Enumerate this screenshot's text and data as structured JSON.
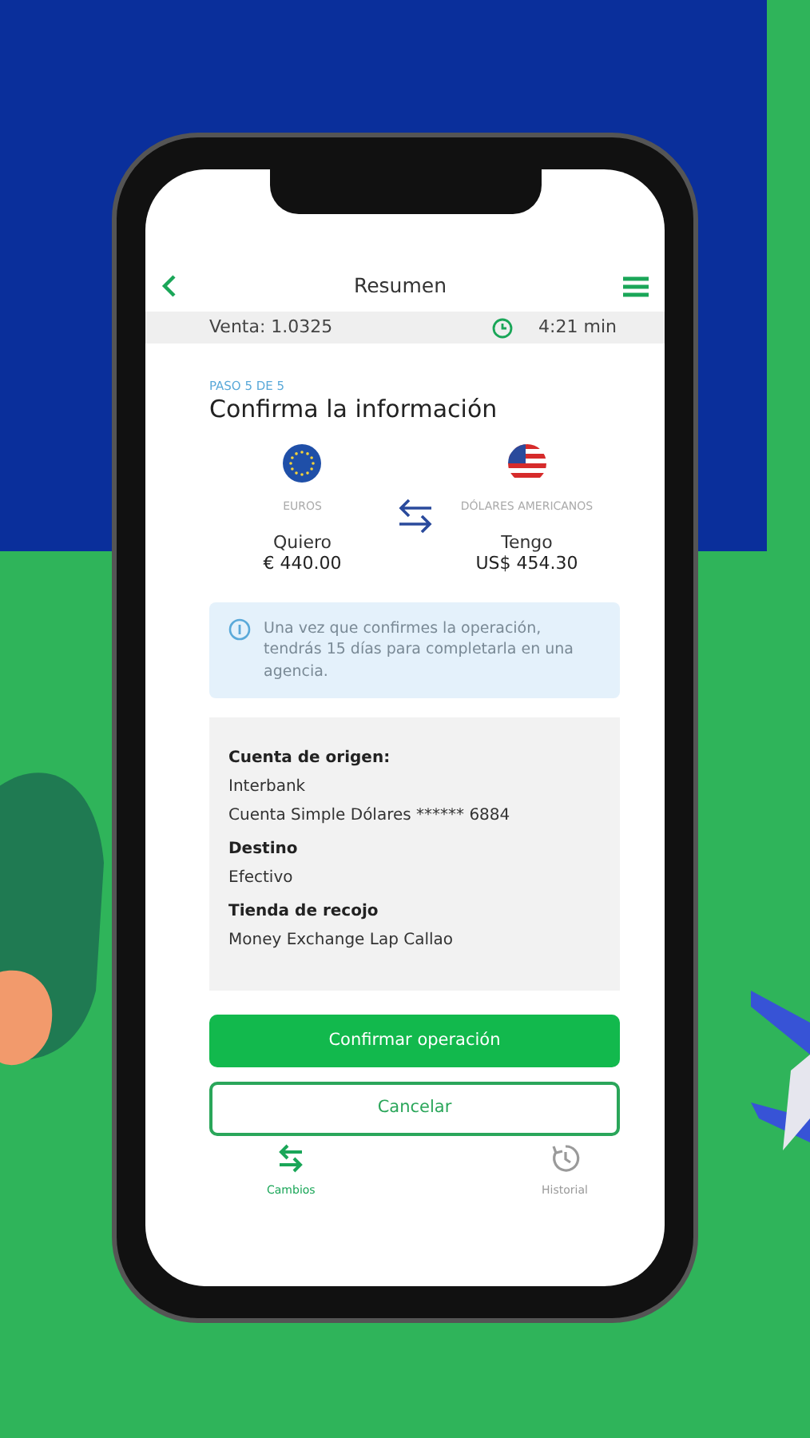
{
  "header": {
    "title": "Resumen"
  },
  "rate_bar": {
    "rate": "Venta: 1.0325",
    "timer": "4:21 min"
  },
  "step": "PASO 5 DE 5",
  "heading": "Confirma la información",
  "exchange": [
    {
      "currency": "EUROS",
      "label": "Quiero",
      "amount": "€ 440.00"
    },
    {
      "currency": "DÓLARES AMERICANOS",
      "label": "Tengo",
      "amount": "US$ 454.30"
    }
  ],
  "notice": "Una vez que confirmes la operación, tendrás 15 días para completarla en una agencia.",
  "details": [
    {
      "label": "Cuenta de origen:",
      "values": [
        "Interbank",
        "Cuenta Simple Dólares ****** 6884"
      ]
    },
    {
      "label": "Destino",
      "values": [
        "Efectivo"
      ]
    },
    {
      "label": "Tienda de recojo",
      "values": [
        "Money Exchange Lap Callao"
      ]
    }
  ],
  "buttons": [
    {
      "label": "Confirmar operación",
      "kind": "primary"
    },
    {
      "label": "Cancelar",
      "kind": "outline"
    }
  ],
  "bottom_nav": [
    {
      "label": "Cambios",
      "selected": true
    },
    {
      "label": "Historial",
      "selected": false
    }
  ]
}
